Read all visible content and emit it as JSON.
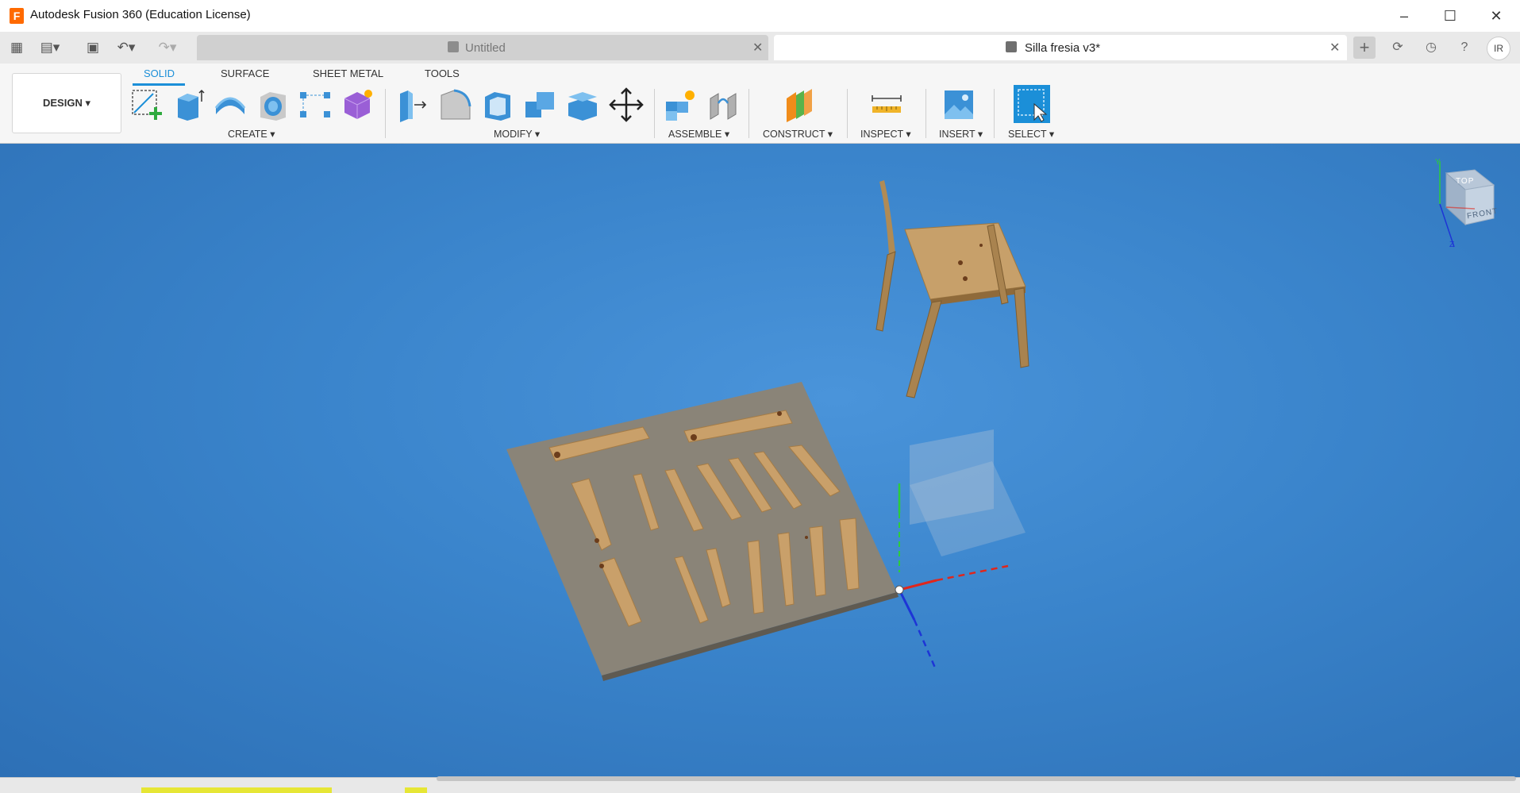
{
  "window": {
    "title": "Autodesk Fusion 360 (Education License)",
    "icon_letter": "F",
    "minimize": "–",
    "maximize": "☐",
    "close": "✕"
  },
  "tabs": [
    {
      "label": "Untitled",
      "active": false,
      "close": "✕"
    },
    {
      "label": "Silla fresia v3*",
      "active": true,
      "close": "✕"
    }
  ],
  "right_controls": {
    "add": "+",
    "profile_initials": "IR"
  },
  "workspace": {
    "label": "DESIGN ▾"
  },
  "ribbon_tabs": [
    "SOLID",
    "SURFACE",
    "SHEET METAL",
    "TOOLS"
  ],
  "groups": {
    "create": "CREATE ▾",
    "modify": "MODIFY ▾",
    "assemble": "ASSEMBLE ▾",
    "construct": "CONSTRUCT ▾",
    "inspect": "INSPECT ▾",
    "insert": "INSERT ▾",
    "select": "SELECT ▾"
  },
  "viewcube": {
    "top": "TOP",
    "front": "FRONT",
    "axis_y": "Y",
    "axis_z": "Z"
  },
  "colors": {
    "accent": "#1b8fd8",
    "viewport": "#3a84cb",
    "wood": "#c9a06a",
    "plate": "#8a8478"
  }
}
